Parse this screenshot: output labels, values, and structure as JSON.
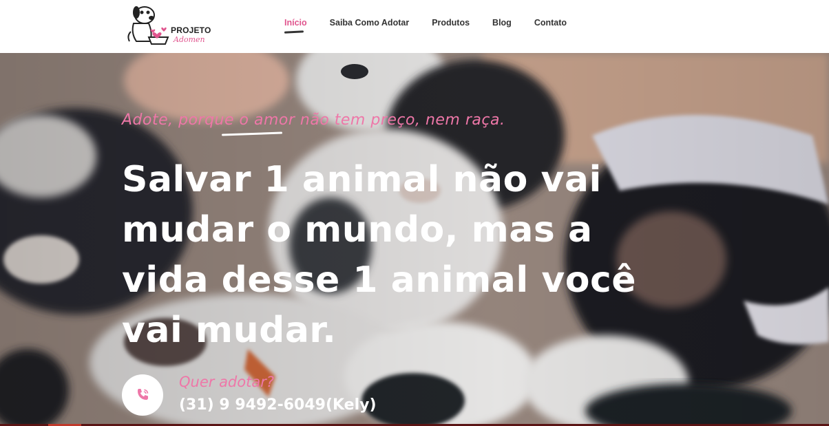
{
  "brand": {
    "line1": "PROJETO",
    "line2": "Adomen",
    "logo_icon": "dog-with-hearts-bowl-icon",
    "accent_color": "#e0558e"
  },
  "nav": {
    "items": [
      {
        "label": "Início",
        "active": true
      },
      {
        "label": "Saiba Como Adotar",
        "active": false
      },
      {
        "label": "Produtos",
        "active": false
      },
      {
        "label": "Blog",
        "active": false
      },
      {
        "label": "Contato",
        "active": false
      }
    ]
  },
  "hero": {
    "tagline": "Adote, porque o amor não tem preço, nem raça.",
    "headline": "Salvar 1 animal não vai mudar o mundo, mas a vida desse 1 animal você vai mudar.",
    "background": "sleeping-puppies-photo"
  },
  "cta": {
    "icon": "phone-icon",
    "label": "Quer adotar?",
    "phone": "(31) 9 9492-6049(Kely)"
  }
}
